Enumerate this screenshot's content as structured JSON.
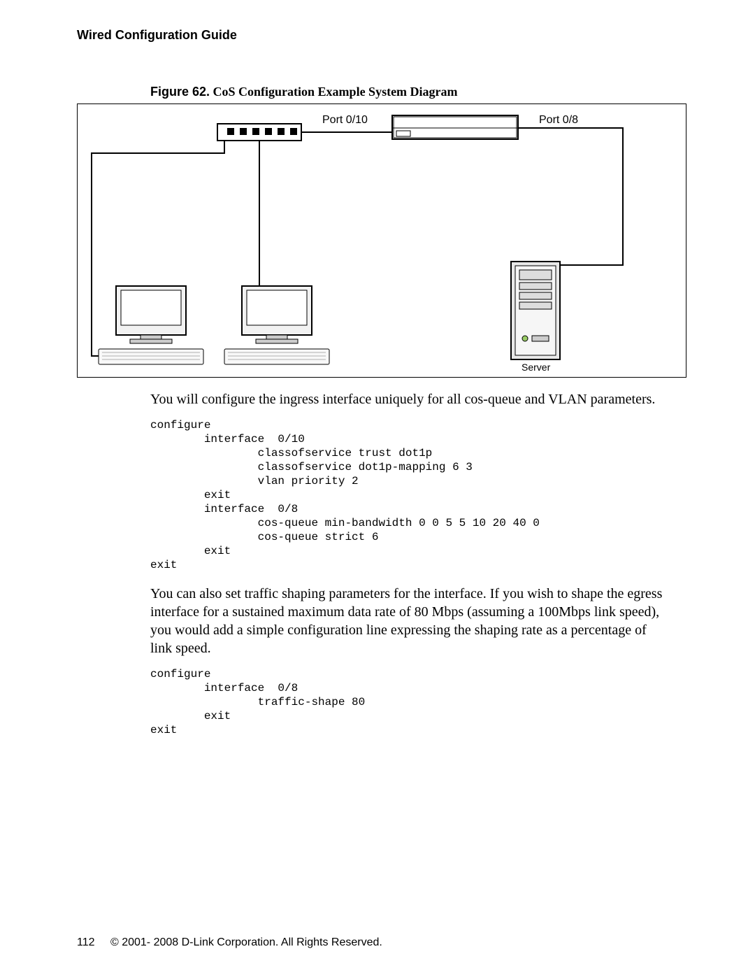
{
  "header": {
    "title": "Wired Configuration Guide"
  },
  "figure": {
    "label": "Figure 62.",
    "title": "CoS Configuration Example System Diagram",
    "port_left": "Port  0/10",
    "port_right": "Port  0/8",
    "server_label": "Server"
  },
  "para1": "You will configure the ingress interface uniquely for all cos-queue and VLAN parameters.",
  "code1": "configure\n        interface  0/10\n                classofservice trust dot1p\n                classofservice dot1p-mapping 6 3\n                vlan priority 2\n        exit\n        interface  0/8\n                cos-queue min-bandwidth 0 0 5 5 10 20 40 0\n                cos-queue strict 6\n        exit\nexit",
  "para2": "You can also set traffic shaping parameters for the interface. If you wish to shape the egress interface for a sustained maximum data rate of 80 Mbps (assuming a 100Mbps link speed), you would add a simple configuration line expressing the shaping rate as a percentage of link speed.",
  "code2": "configure\n        interface  0/8\n                traffic-shape 80\n        exit\nexit",
  "footer": {
    "page": "112",
    "copyright": "© 2001- 2008 D-Link Corporation. All Rights Reserved."
  }
}
